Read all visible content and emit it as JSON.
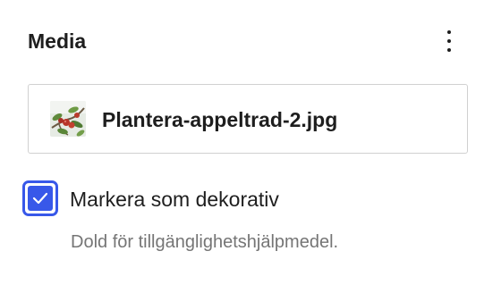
{
  "panel": {
    "title": "Media",
    "menu_icon": "more-vertical-icon"
  },
  "media": {
    "thumbnail_icon": "apple-branch-thumbnail",
    "filename": "Plantera-appeltrad-2.jpg"
  },
  "decorative": {
    "checked": true,
    "label": "Markera som dekorativ",
    "help": "Dold för tillgänglighetshjälpmedel."
  },
  "colors": {
    "accent": "#3858e9",
    "text": "#1e1e1e",
    "muted": "#757575",
    "border": "#d0d0d0"
  }
}
